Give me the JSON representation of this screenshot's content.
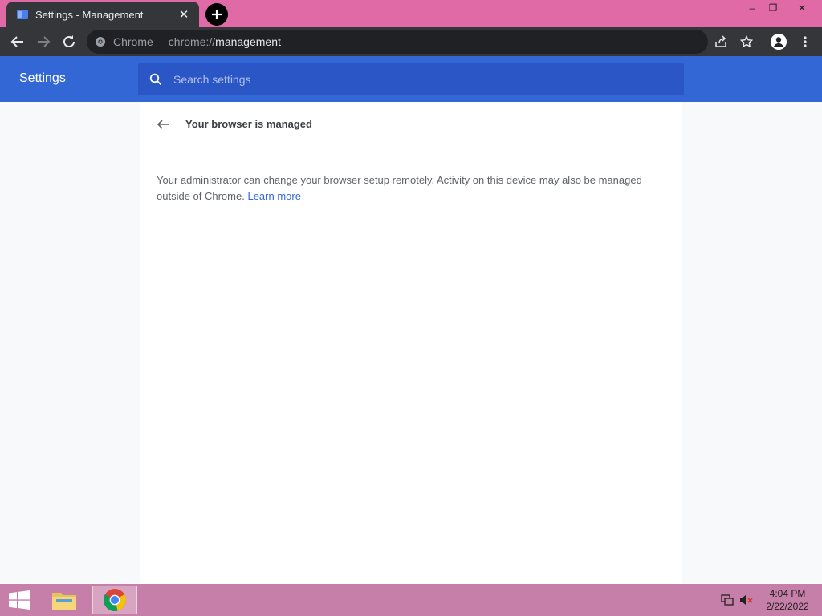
{
  "tab": {
    "title": "Settings - Management",
    "close_glyph": "✕"
  },
  "window": {
    "min_glyph": "–",
    "max_glyph": "❐",
    "close_glyph": "✕"
  },
  "omnibox": {
    "site_label": "Chrome",
    "url_prefix": "chrome://",
    "url_path": "management"
  },
  "settings": {
    "title": "Settings",
    "search_placeholder": "Search settings"
  },
  "page": {
    "heading": "Your browser is managed",
    "description": "Your administrator can change your browser setup remotely. Activity on this device may also be managed outside of Chrome.",
    "learn_more": "Learn more"
  },
  "taskbar": {
    "time": "4:04 PM",
    "date": "2/22/2022"
  },
  "colors": {
    "tab_strip": "#e06aa5",
    "toolbar": "#35363a",
    "header": "#3367d6",
    "search": "#2a56c6",
    "taskbar": "#c67fa8"
  }
}
